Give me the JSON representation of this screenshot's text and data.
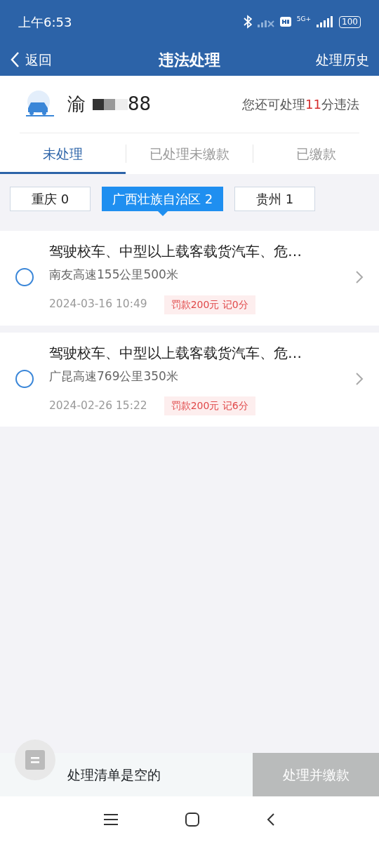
{
  "status_bar": {
    "time": "上午6:53",
    "battery": "100",
    "network": "5G+"
  },
  "nav": {
    "back": "返回",
    "title": "违法处理",
    "history": "处理历史"
  },
  "vehicle": {
    "plate_prefix": "渝",
    "plate_suffix": "88",
    "quota": {
      "before": "您还可处理",
      "points": "11",
      "after": "分违法"
    }
  },
  "tabs": [
    {
      "label": "未处理",
      "selected": true
    },
    {
      "label": "已处理未缴款",
      "selected": false
    },
    {
      "label": "已缴款",
      "selected": false
    }
  ],
  "regions": [
    {
      "label": "重庆 0",
      "selected": false
    },
    {
      "label": "广西壮族自治区 2",
      "selected": true
    },
    {
      "label": "贵州 1",
      "selected": false
    }
  ],
  "violations": [
    {
      "title": "驾驶校车、中型以上载客载货汽车、危…",
      "location": "南友高速155公里500米",
      "time": "2024-03-16 10:49",
      "penalty": "罚款200元 记0分",
      "checked": false
    },
    {
      "title": "驾驶校车、中型以上载客载货汽车、危…",
      "location": "广昆高速769公里350米",
      "time": "2024-02-26 15:22",
      "penalty": "罚款200元 记6分",
      "checked": false
    }
  ],
  "bottom_bar": {
    "cart_text": "处理清单是空的",
    "button": {
      "label": "处理并缴款",
      "disabled": true
    }
  }
}
